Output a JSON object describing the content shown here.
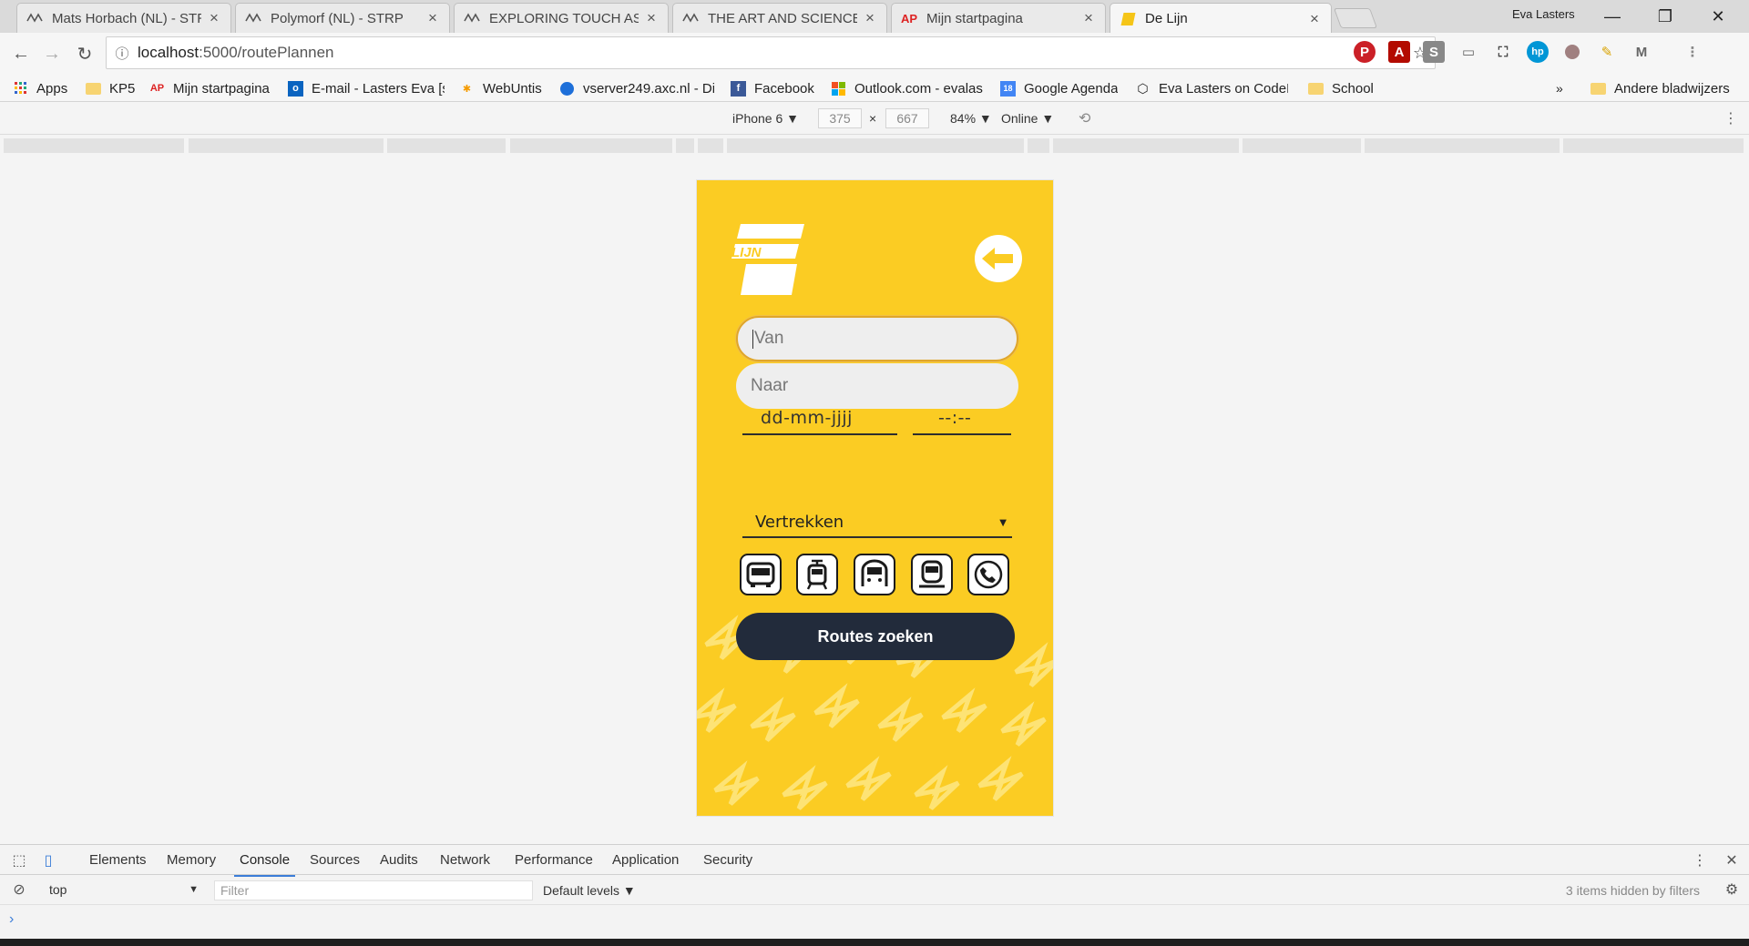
{
  "browser": {
    "tabs": [
      {
        "title": "Mats Horbach (NL) - STR",
        "favicon": "strp-icon"
      },
      {
        "title": "Polymorf (NL) - STRP",
        "favicon": "strp-icon"
      },
      {
        "title": "EXPLORING TOUCH AS A",
        "favicon": "strp-icon"
      },
      {
        "title": "THE ART AND SCIENCE C",
        "favicon": "strp-icon"
      },
      {
        "title": "Mijn startpagina",
        "favicon": "ap-icon"
      },
      {
        "title": "De Lijn",
        "favicon": "de-lijn-icon",
        "active": true
      }
    ],
    "user_name": "Eva Lasters",
    "url_host": "localhost",
    "url_path": ":5000/routePlannen",
    "bookmarks": [
      {
        "label": "Apps",
        "icon": "apps-grid-icon"
      },
      {
        "label": "KP5",
        "icon": "folder-icon"
      },
      {
        "label": "Mijn startpagina",
        "icon": "ap-icon"
      },
      {
        "label": "E-mail - Lasters Eva [s",
        "icon": "outlook-icon"
      },
      {
        "label": "WebUntis",
        "icon": "webuntis-icon"
      },
      {
        "label": "vserver249.axc.nl - Di",
        "icon": "globe-icon"
      },
      {
        "label": "Facebook",
        "icon": "facebook-icon"
      },
      {
        "label": "Outlook.com - evalas",
        "icon": "outlook-com-icon"
      },
      {
        "label": "Google Agenda",
        "icon": "google-calendar-icon"
      },
      {
        "label": "Eva Lasters on CodeP",
        "icon": "codepen-icon"
      },
      {
        "label": "School",
        "icon": "folder-icon"
      }
    ],
    "bookmarks_overflow": "»",
    "other_bookmarks": "Andere bladwijzers"
  },
  "device_toolbar": {
    "device": "iPhone 6 ▼",
    "width": "375",
    "times": "×",
    "height": "667",
    "zoom": "84% ▼",
    "network": "Online ▼"
  },
  "app": {
    "logo_text": "LIJN",
    "from_placeholder": "Van",
    "to_placeholder": "Naar",
    "date_placeholder": "dd-mm-jjjj",
    "time_placeholder": "--:--",
    "mode_select": "Vertrekken",
    "transport_buttons": [
      "bus-icon",
      "tram-icon",
      "metro-icon",
      "train-icon",
      "phone-icon"
    ],
    "submit_label": "Routes zoeken",
    "colors": {
      "yellow": "#fbcc23",
      "dark": "#222b3b",
      "field": "#eeeeee"
    }
  },
  "devtools": {
    "tabs": [
      "Elements",
      "Memory",
      "Console",
      "Sources",
      "Audits",
      "Network",
      "Performance",
      "Application",
      "Security"
    ],
    "active_tab": "Console",
    "context": "top",
    "filter_placeholder": "Filter",
    "levels": "Default levels ▼",
    "hidden_note": "3 items hidden by filters",
    "prompt": "›"
  }
}
